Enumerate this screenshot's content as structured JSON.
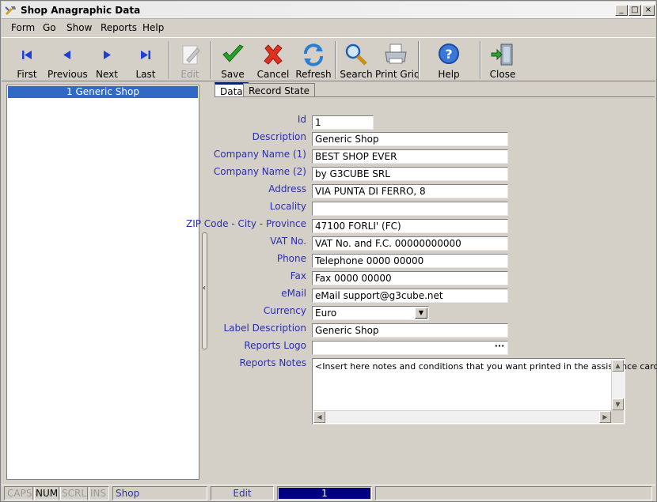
{
  "window": {
    "title": "Shop Anagraphic Data",
    "controls": {
      "minimize": "_",
      "maximize": "□",
      "close": "×"
    }
  },
  "menu": [
    "Form",
    "Go",
    "Show",
    "Reports",
    "Help"
  ],
  "toolbar": {
    "first": "First",
    "previous": "Previous",
    "next": "Next",
    "last": "Last",
    "edit": "Edit",
    "save": "Save",
    "cancel": "Cancel",
    "refresh": "Refresh",
    "search": "Search",
    "print_grid": "Print Grid",
    "help": "Help",
    "close": "Close"
  },
  "list": {
    "items": [
      "1 Generic Shop"
    ]
  },
  "tabs": [
    "Data",
    "Record State"
  ],
  "form": {
    "id": {
      "label": "Id",
      "value": "1"
    },
    "description": {
      "label": "Description",
      "value": "Generic Shop"
    },
    "company1": {
      "label": "Company Name (1)",
      "value": "BEST SHOP EVER"
    },
    "company2": {
      "label": "Company Name (2)",
      "value": "by G3CUBE SRL"
    },
    "address": {
      "label": "Address",
      "value": "VIA PUNTA DI FERRO, 8"
    },
    "locality": {
      "label": "Locality",
      "value": ""
    },
    "zip": {
      "label": "ZIP Code - City - Province",
      "value": "47100 FORLI' (FC)"
    },
    "vat": {
      "label": "VAT No.",
      "value": "VAT No. and F.C. 00000000000"
    },
    "phone": {
      "label": "Phone",
      "value": "Telephone 0000 00000"
    },
    "fax": {
      "label": "Fax",
      "value": "Fax 0000 00000"
    },
    "email": {
      "label": "eMail",
      "value": "eMail support@g3cube.net"
    },
    "currency": {
      "label": "Currency",
      "value": "Euro"
    },
    "label_description": {
      "label": "Label Description",
      "value": "Generic Shop"
    },
    "reports_logo": {
      "label": "Reports Logo",
      "value": "",
      "button": "···"
    },
    "reports_notes": {
      "label": "Reports Notes",
      "value": "<Insert here notes and conditions that you want printed in the assistance card>"
    }
  },
  "status": {
    "caps": "CAPS",
    "num": "NUM",
    "scrl": "SCRL",
    "ins": "INS",
    "form": "Shop",
    "mode": "Edit",
    "record": "1"
  },
  "colors": {
    "accent": "#0a246a",
    "label": "#2a30a8",
    "selection": "#316ac5",
    "record_indicator": "#000080"
  }
}
